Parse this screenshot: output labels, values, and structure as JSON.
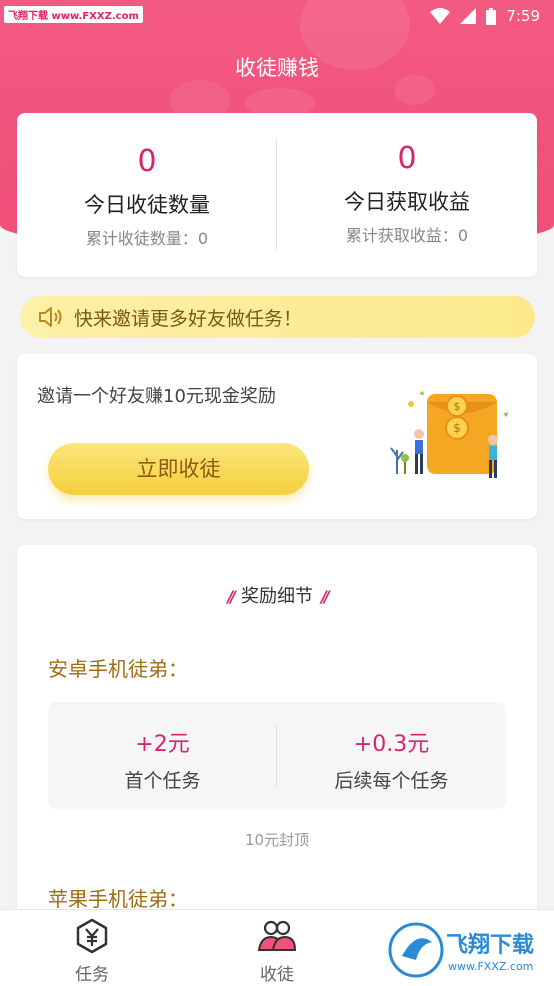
{
  "watermark": "飞翔下载 www.FXXZ.com",
  "status_bar": {
    "time": "7:59"
  },
  "header": {
    "title": "收徒赚钱"
  },
  "stats": {
    "left": {
      "value": "0",
      "label": "今日收徒数量",
      "sub": "累计收徒数量：0"
    },
    "right": {
      "value": "0",
      "label": "今日获取收益",
      "sub": "累计获取收益：0"
    }
  },
  "notice": {
    "text": "快来邀请更多好友做任务！"
  },
  "invite": {
    "description": "邀请一个好友赚10元现金奖励",
    "button_label": "立即收徒"
  },
  "rewards": {
    "heading": "奖励细节",
    "android": {
      "title": "安卓手机徒弟：",
      "first": {
        "value": "+2元",
        "label": "首个任务"
      },
      "later": {
        "value": "+0.3元",
        "label": "后续每个任务"
      },
      "cap": "10元封顶"
    },
    "ios": {
      "title": "苹果手机徒弟："
    }
  },
  "tabbar": {
    "items": [
      {
        "label": "任务",
        "icon": "yuan-hexagon-icon"
      },
      {
        "label": "收徒",
        "icon": "users-icon"
      }
    ]
  },
  "brand": {
    "name": "飞翔下载",
    "url": "www.FXXZ.com"
  },
  "colors": {
    "primary": "#ef4f78",
    "accent": "#d6256b",
    "gold": "#f6cf3e"
  }
}
